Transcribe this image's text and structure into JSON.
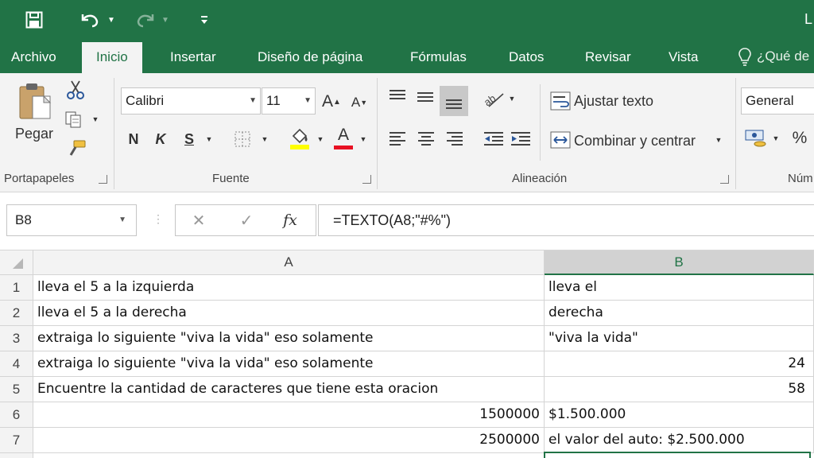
{
  "title_fragment": "L",
  "tabs": {
    "archivo": "Archivo",
    "inicio": "Inicio",
    "insertar": "Insertar",
    "diseno": "Diseño de página",
    "formulas": "Fórmulas",
    "datos": "Datos",
    "revisar": "Revisar",
    "vista": "Vista",
    "tell_me": "¿Qué de"
  },
  "ribbon": {
    "clipboard": {
      "paste_label": "Pegar",
      "group_label": "Portapapeles"
    },
    "font": {
      "name": "Calibri",
      "size": "11",
      "grow": "A",
      "shrink": "A",
      "bold": "N",
      "italic": "K",
      "underline": "S",
      "fill_letter": "A",
      "group_label": "Fuente",
      "fill_color": "#ffff00",
      "font_color": "#e81123"
    },
    "alignment": {
      "wrap_text": "Ajustar texto",
      "merge_center": "Combinar y centrar",
      "group_label": "Alineación"
    },
    "number": {
      "format": "General",
      "percent": "%",
      "group_label": "Núm"
    }
  },
  "formula_bar": {
    "name_box": "B8",
    "cancel": "✕",
    "enter": "✓",
    "fx": "fx",
    "formula": "=TEXTO(A8;\"#%\")"
  },
  "grid": {
    "col_headers": [
      "A",
      "B"
    ],
    "row_headers": [
      "1",
      "2",
      "3",
      "4",
      "5",
      "6",
      "7"
    ],
    "rows": [
      {
        "a": "lleva el 5 a la izquierda",
        "b": "lleva el"
      },
      {
        "a": "lleva el 5 a la derecha",
        "b": "derecha"
      },
      {
        "a": "extraiga lo siguiente \"viva la vida\" eso solamente",
        "b": "\"viva la vida\""
      },
      {
        "a": "extraiga lo siguiente \"viva la vida\" eso solamente",
        "b": "24"
      },
      {
        "a": "Encuentre la cantidad de caracteres que tiene esta oracion",
        "b": "58"
      },
      {
        "a": "1500000",
        "b": "$1.500.000"
      },
      {
        "a": "2500000",
        "b": "el valor del auto: $2.500.000"
      }
    ]
  },
  "colors": {
    "accent": "#217346",
    "ribbon_bg": "#f3f3f3"
  }
}
